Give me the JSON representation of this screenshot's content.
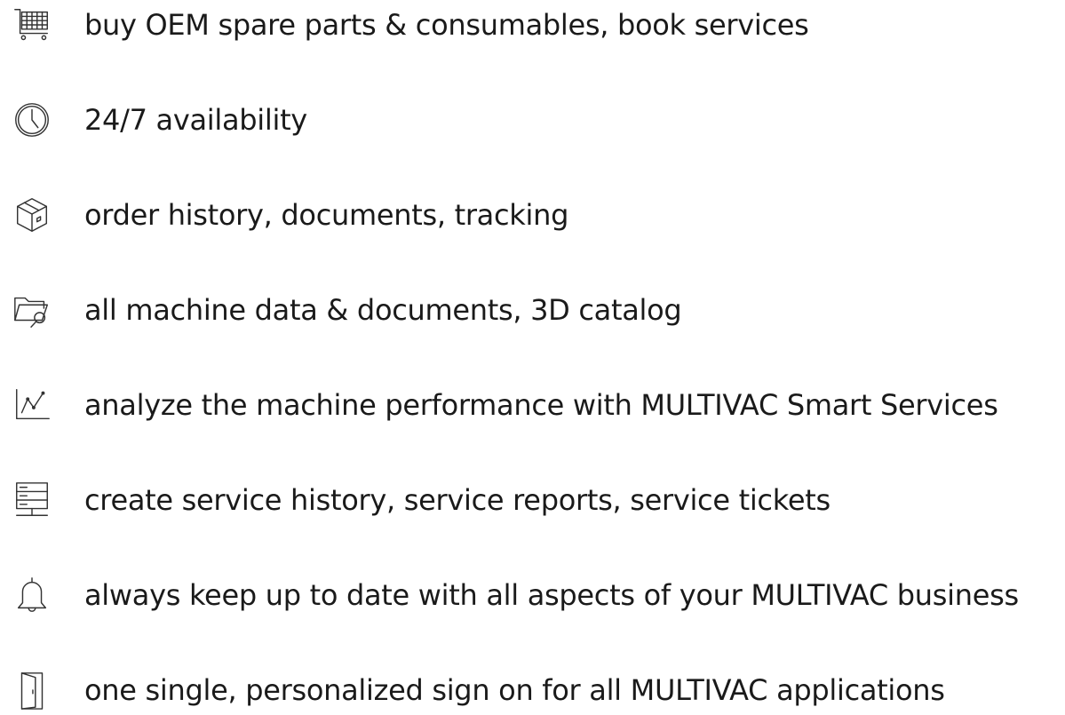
{
  "features": [
    {
      "icon": "shopping-cart-icon",
      "text": "buy OEM spare parts & consumables, book services"
    },
    {
      "icon": "clock-icon",
      "text": "24/7 availability"
    },
    {
      "icon": "package-box-icon",
      "text": "order history, documents, tracking"
    },
    {
      "icon": "folder-search-icon",
      "text": "all machine data & documents, 3D catalog"
    },
    {
      "icon": "line-chart-icon",
      "text": "analyze the machine performance with MULTIVAC Smart Services"
    },
    {
      "icon": "server-icon",
      "text": "create service history, service reports, service tickets"
    },
    {
      "icon": "bell-icon",
      "text": "always keep up to date with all aspects of your MULTIVAC business"
    },
    {
      "icon": "door-icon",
      "text": "one single, personalized sign on for all MULTIVAC applications"
    }
  ]
}
